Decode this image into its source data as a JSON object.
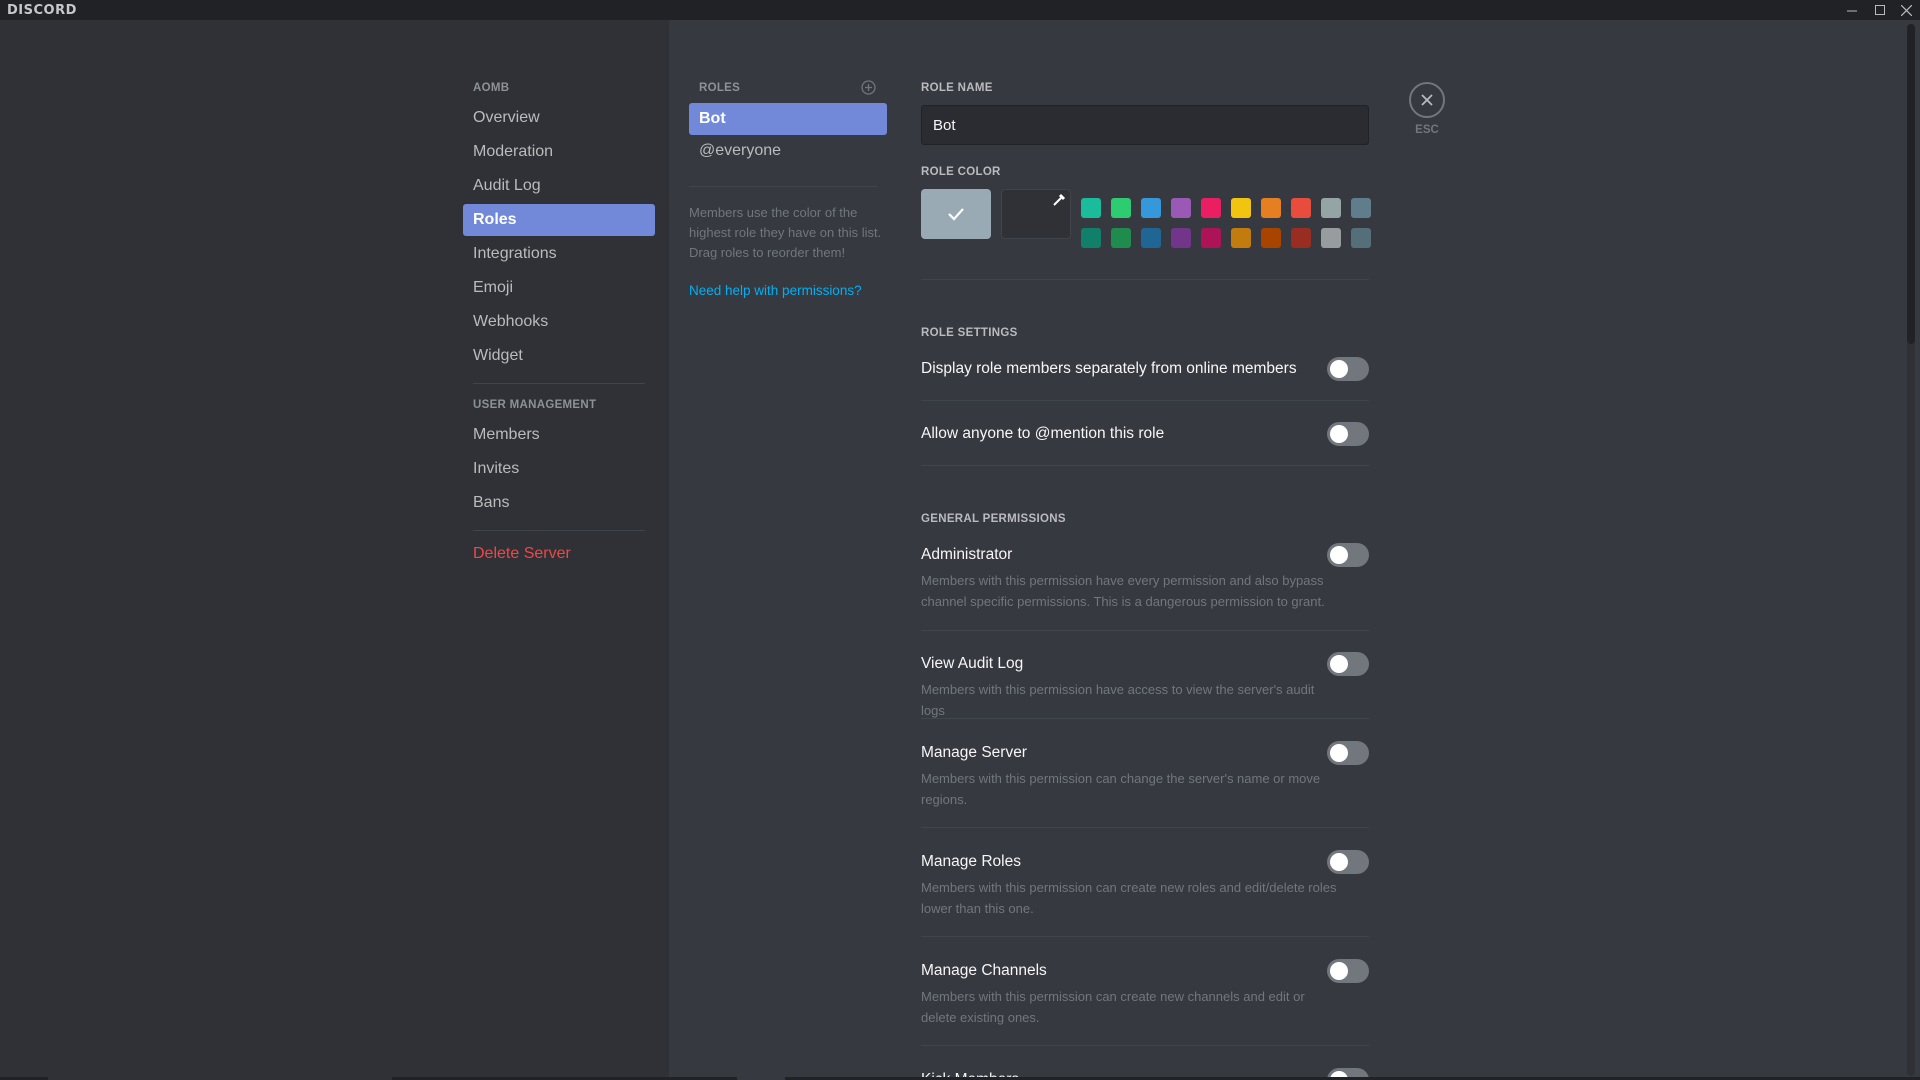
{
  "app": {
    "brand": "DISCORD"
  },
  "window_controls": [
    "minimize-icon",
    "maximize-icon",
    "close-icon"
  ],
  "sidebar": {
    "server_header": "AOMB",
    "server_items": [
      {
        "label": "Overview"
      },
      {
        "label": "Moderation"
      },
      {
        "label": "Audit Log"
      },
      {
        "label": "Roles",
        "active": true
      },
      {
        "label": "Integrations"
      },
      {
        "label": "Emoji"
      },
      {
        "label": "Webhooks"
      },
      {
        "label": "Widget"
      }
    ],
    "user_header": "USER MANAGEMENT",
    "user_items": [
      {
        "label": "Members"
      },
      {
        "label": "Invites"
      },
      {
        "label": "Bans"
      }
    ],
    "delete_label": "Delete Server"
  },
  "roles": {
    "header": "ROLES",
    "items": [
      {
        "label": "Bot",
        "active": true
      },
      {
        "label": "@everyone"
      }
    ],
    "description": "Members use the color of the highest role they have on this list. Drag roles to reorder them!",
    "help_link": "Need help with permissions?"
  },
  "editor": {
    "role_name_label": "ROLE NAME",
    "role_name_value": "Bot",
    "role_color_label": "ROLE COLOR",
    "default_color": "#99aab5",
    "swatches_top": [
      "#1abc9c",
      "#2ecc71",
      "#3498db",
      "#9b59b6",
      "#e91e63",
      "#f1c40f",
      "#e67e22",
      "#e74c3c",
      "#95a5a6",
      "#607d8b"
    ],
    "swatches_bottom": [
      "#11806a",
      "#1f8b4c",
      "#206694",
      "#71368a",
      "#ad1457",
      "#c27c0e",
      "#a84300",
      "#992d22",
      "#979c9f",
      "#546e7a"
    ],
    "role_settings_label": "ROLE SETTINGS",
    "role_settings": [
      {
        "title": "Display role members separately from online members",
        "enabled": false
      },
      {
        "title": "Allow anyone to @mention this role",
        "enabled": false
      }
    ],
    "general_permissions_label": "GENERAL PERMISSIONS",
    "permissions": [
      {
        "title": "Administrator",
        "desc": "Members with this permission have every permission and also bypass channel specific permissions. This is a dangerous permission to grant.",
        "enabled": false
      },
      {
        "title": "View Audit Log",
        "desc": "Members with this permission have access to view the server's audit logs",
        "enabled": false
      },
      {
        "title": "Manage Server",
        "desc": "Members with this permission can change the server's name or move regions.",
        "enabled": false
      },
      {
        "title": "Manage Roles",
        "desc": "Members with this permission can create new roles and edit/delete roles lower than this one.",
        "enabled": false
      },
      {
        "title": "Manage Channels",
        "desc": "Members with this permission can create new channels and edit or delete existing ones.",
        "enabled": false
      },
      {
        "title": "Kick Members",
        "desc": "",
        "enabled": false
      }
    ]
  },
  "close": {
    "esc_label": "ESC"
  }
}
